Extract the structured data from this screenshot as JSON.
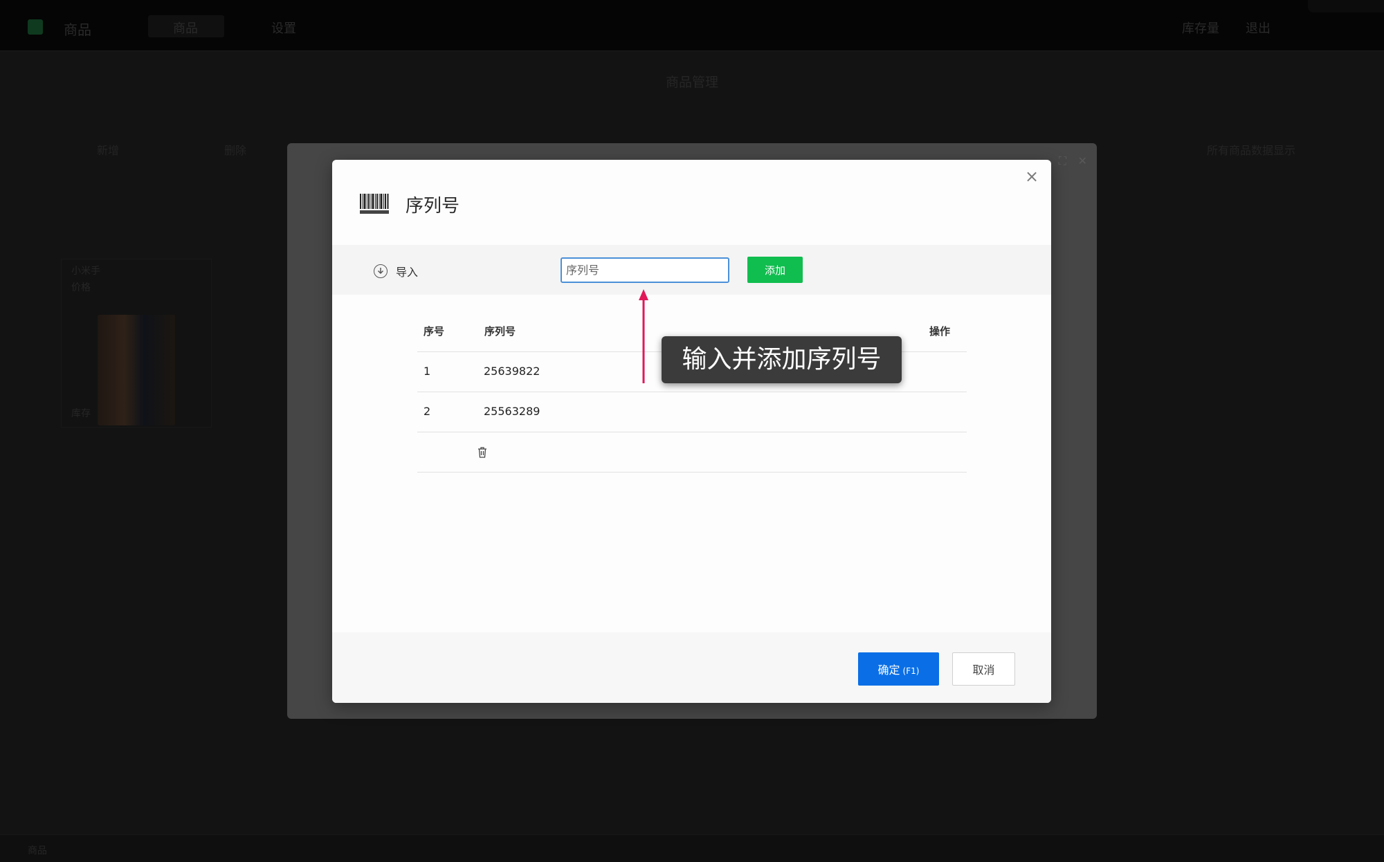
{
  "background": {
    "app_name": "商品",
    "tabs": [
      "商品",
      "设置"
    ],
    "header_right": [
      "库存量",
      "退出"
    ],
    "page_title": "商品管理",
    "toolbar": [
      "新增",
      "删除"
    ],
    "toolbar_right": "所有商品数据显示",
    "card": {
      "name": "小米手",
      "price": "价格",
      "footer": "库存"
    },
    "footer_text": "商品"
  },
  "modal": {
    "title": "序列号",
    "close": "×",
    "import_label": "导入",
    "input": {
      "placeholder": "序列号",
      "value": ""
    },
    "add_label": "添加",
    "columns": [
      "序号",
      "序列号",
      "操作"
    ],
    "rows": [
      {
        "index": "1",
        "serial": "25639822"
      },
      {
        "index": "2",
        "serial": "25563289"
      }
    ],
    "confirm_label": "确定",
    "confirm_shortcut": "(F1)",
    "cancel_label": "取消"
  },
  "annotation": {
    "text": "输入并添加序列号",
    "arrow_color": "#e0185a"
  },
  "colors": {
    "add_button": "#10bd4f",
    "confirm_button": "#0a6fe6",
    "input_focus_border": "#4a90d9"
  }
}
